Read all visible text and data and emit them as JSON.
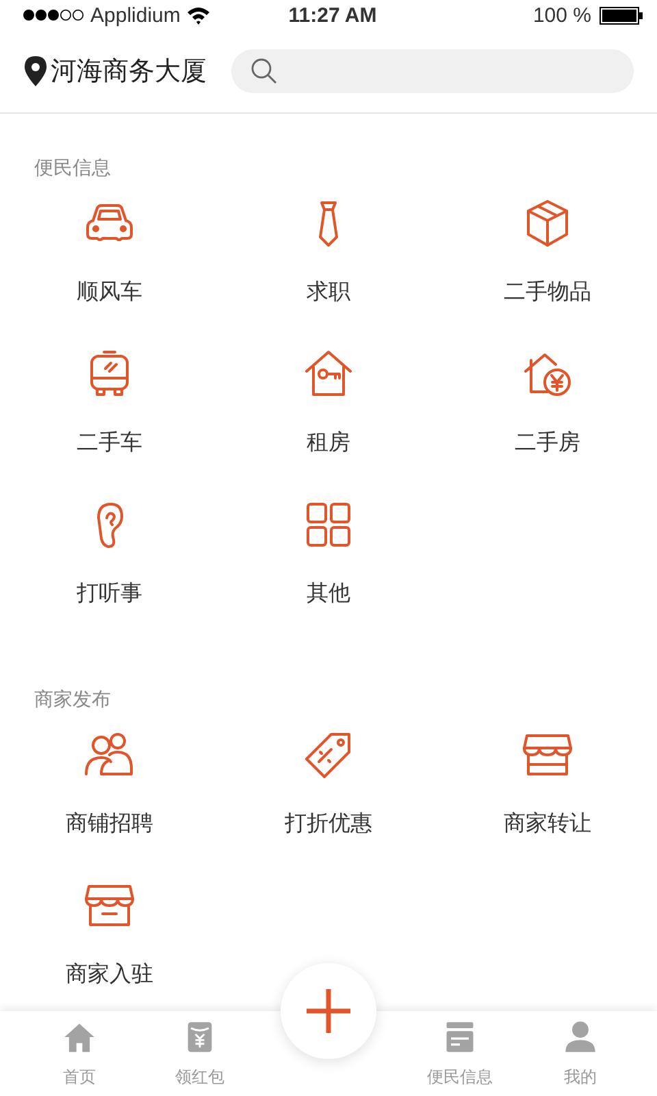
{
  "status_bar": {
    "carrier": "Applidium",
    "time": "11:27 AM",
    "battery": "100 %"
  },
  "header": {
    "location": "河海商务大厦"
  },
  "sections": [
    {
      "title": "便民信息",
      "items": [
        {
          "label": "顺风车"
        },
        {
          "label": "求职"
        },
        {
          "label": "二手物品"
        },
        {
          "label": "二手车"
        },
        {
          "label": "租房"
        },
        {
          "label": "二手房"
        },
        {
          "label": "打听事"
        },
        {
          "label": "其他"
        }
      ]
    },
    {
      "title": "商家发布",
      "items": [
        {
          "label": "商铺招聘"
        },
        {
          "label": "打折优惠"
        },
        {
          "label": "商家转让"
        },
        {
          "label": "商家入驻"
        }
      ]
    }
  ],
  "tab_bar": {
    "items": [
      {
        "label": "首页"
      },
      {
        "label": "领红包"
      },
      {
        "label": "便民信息"
      },
      {
        "label": "我的"
      }
    ]
  }
}
